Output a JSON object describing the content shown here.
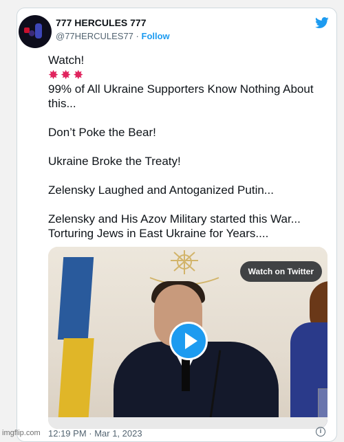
{
  "tweet": {
    "user": {
      "name": "777 HERCULES 777",
      "handle": "@77HERCULES77",
      "separator": "·",
      "follow_label": "Follow"
    },
    "lines": [
      "Watch!",
      "💥💥💥",
      "99% of All Ukraine Supporters Know Nothing About",
      "this...",
      "",
      "Don’t Poke the Bear!",
      "",
      "Ukraine Broke the Treaty!",
      "",
      "Zelensky Laughed and Antoganized Putin...",
      "",
      "Zelensky and His Azov Military started this War...",
      "Torturing Jews in East Ukraine for Years...."
    ],
    "video": {
      "watch_label": "Watch on Twitter"
    },
    "timestamp": "12:19 PM · Mar 1, 2023",
    "info_symbol": "i"
  },
  "watermark": "imgflip.com",
  "icons": {
    "brand": "twitter-bird-icon",
    "play": "play-icon",
    "info": "info-icon",
    "emoji": "collision-emoji"
  },
  "colors": {
    "accent": "#1d9bf0",
    "text": "#0f1419",
    "muted": "#536471"
  }
}
